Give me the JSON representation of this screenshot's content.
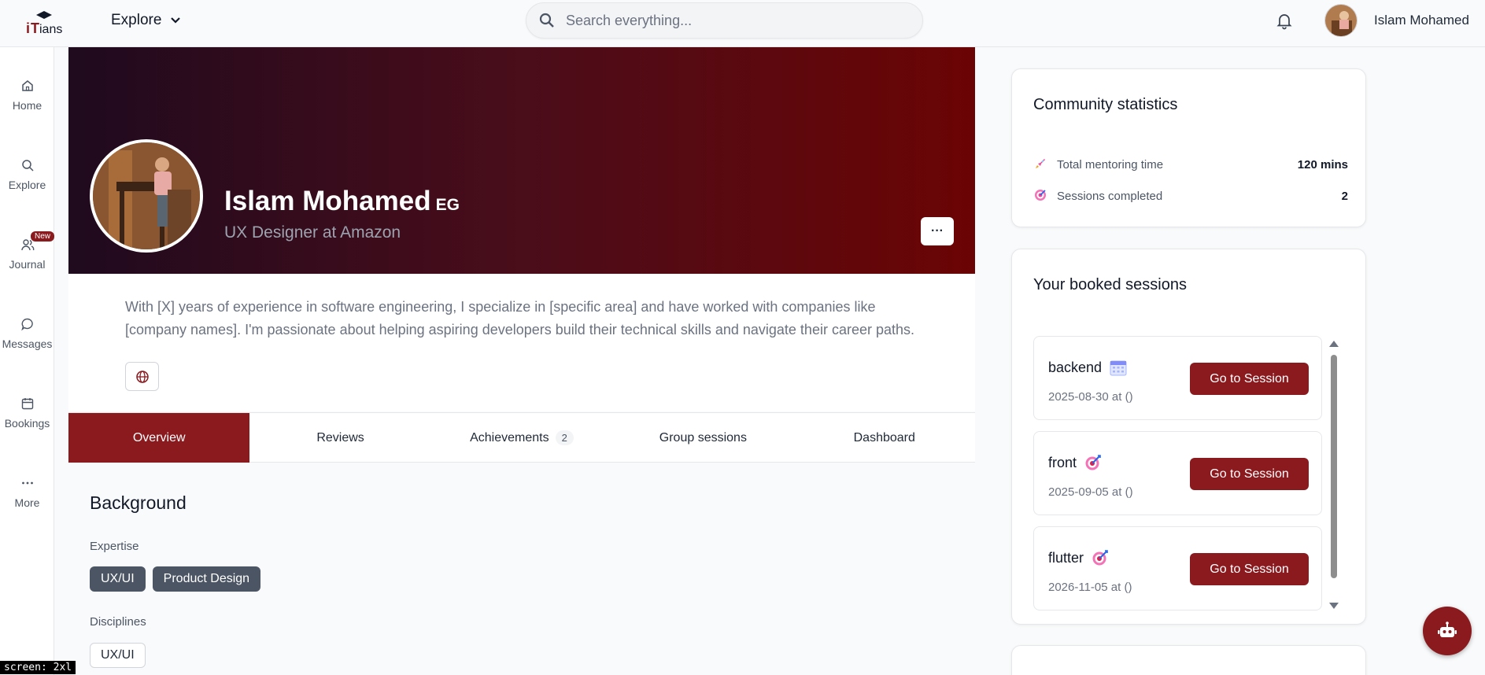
{
  "header": {
    "logo_text": "iTians",
    "explore_label": "Explore",
    "search_placeholder": "Search everything...",
    "user_name": "Islam Mohamed"
  },
  "sidebar": {
    "items": [
      {
        "label": "Home",
        "icon": "home-icon"
      },
      {
        "label": "Explore",
        "icon": "search-icon"
      },
      {
        "label": "Journal",
        "icon": "users-icon",
        "badge": "New"
      },
      {
        "label": "Messages",
        "icon": "message-icon"
      },
      {
        "label": "Bookings",
        "icon": "calendar-icon"
      },
      {
        "label": "More",
        "icon": "more-dots-icon"
      }
    ]
  },
  "profile": {
    "name": "Islam Mohamed",
    "country_code": "EG",
    "title": "UX Designer at Amazon",
    "more_label": "···",
    "bio": "With [X] years of experience in software engineering, I specialize in [specific area] and have worked with companies like [company names]. I'm passionate about helping aspiring developers build their technical skills and navigate their career paths."
  },
  "tabs": [
    {
      "label": "Overview",
      "active": true
    },
    {
      "label": "Reviews"
    },
    {
      "label": "Achievements",
      "count": "2"
    },
    {
      "label": "Group sessions"
    },
    {
      "label": "Dashboard"
    }
  ],
  "background": {
    "title": "Background",
    "expertise_label": "Expertise",
    "expertise": [
      "UX/UI",
      "Product Design"
    ],
    "disciplines_label": "Disciplines",
    "disciplines": [
      "UX/UI"
    ]
  },
  "community_stats": {
    "title": "Community statistics",
    "rows": [
      {
        "label": "Total mentoring time",
        "value": "120 mins",
        "icon": "rocket-icon"
      },
      {
        "label": "Sessions completed",
        "value": "2",
        "icon": "target-icon"
      }
    ]
  },
  "booked_sessions": {
    "title": "Your booked sessions",
    "button_label": "Go to Session",
    "items": [
      {
        "name": "backend",
        "date": "2025-08-30 at ()",
        "icon": "calendar-emoji-icon"
      },
      {
        "name": "front",
        "date": "2025-09-05 at ()",
        "icon": "target-icon"
      },
      {
        "name": "flutter",
        "date": "2026-11-05 at ()",
        "icon": "target-icon"
      }
    ]
  },
  "screen_tag": "screen: 2xl",
  "colors": {
    "brand": "#8b1a1f",
    "banner_start": "#1f0a1e",
    "banner_end": "#6b0404"
  }
}
